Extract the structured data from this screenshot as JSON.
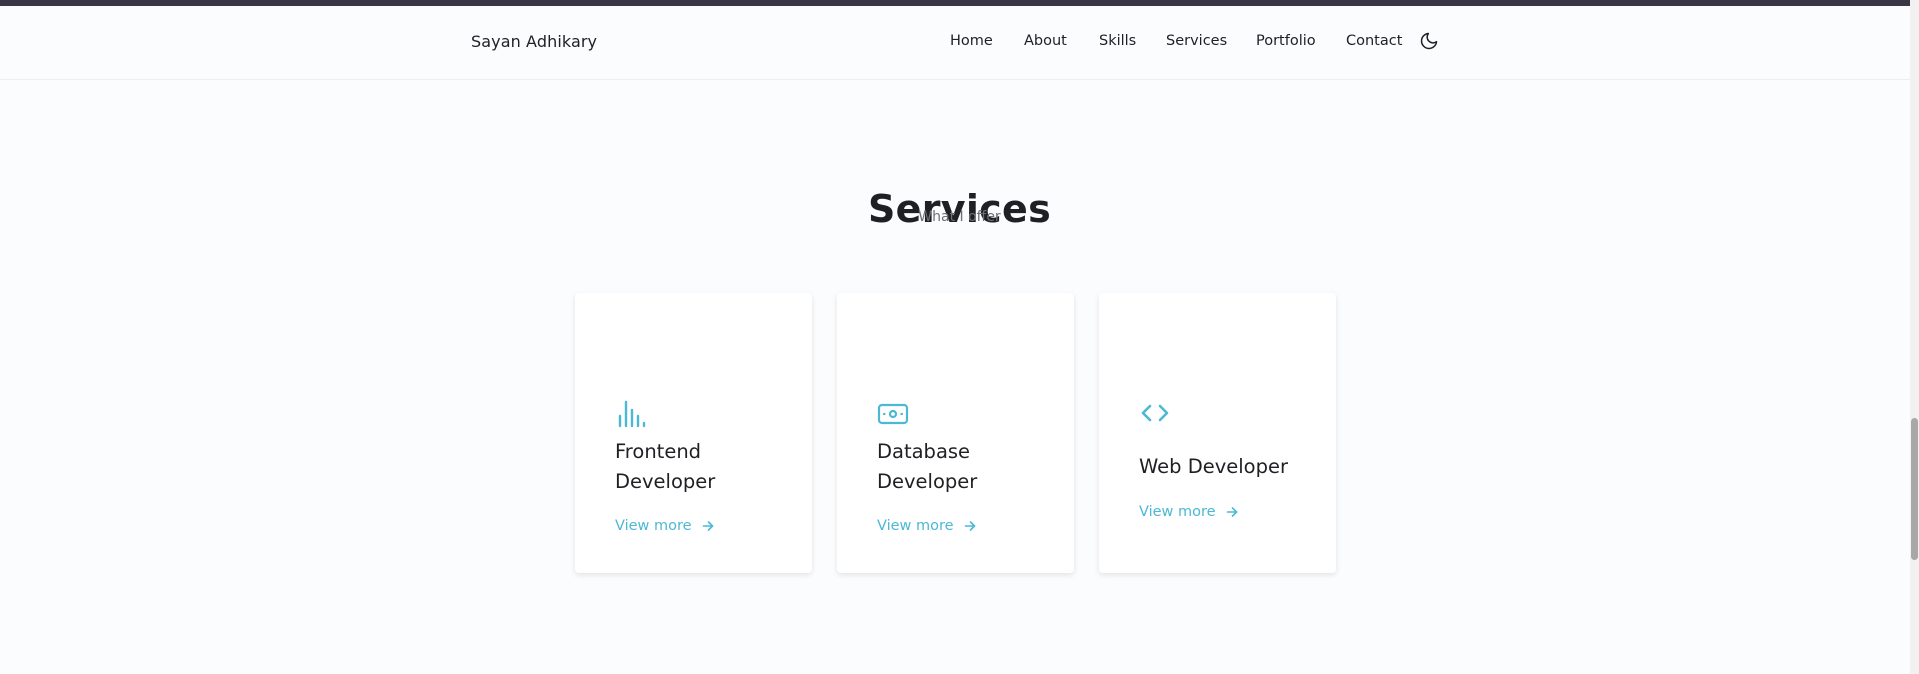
{
  "header": {
    "brand": "Sayan Adhikary",
    "nav": [
      "Home",
      "About",
      "Skills",
      "Services",
      "Portfolio",
      "Contact"
    ],
    "theme_icon": "moon-icon"
  },
  "section": {
    "title": "Services",
    "subtitle": "What I offer"
  },
  "cards": [
    {
      "icon": "bar-chart-icon",
      "title": "Frontend Developer",
      "link": "View more"
    },
    {
      "icon": "money-bill-icon",
      "title": "Database Developer",
      "link": "View more"
    },
    {
      "icon": "code-icon",
      "title": "Web Developer",
      "link": "View more"
    }
  ],
  "colors": {
    "accent": "#4cb8d4",
    "text": "#1f1f24",
    "muted": "#6f6f78",
    "background": "#fbfcfe"
  }
}
